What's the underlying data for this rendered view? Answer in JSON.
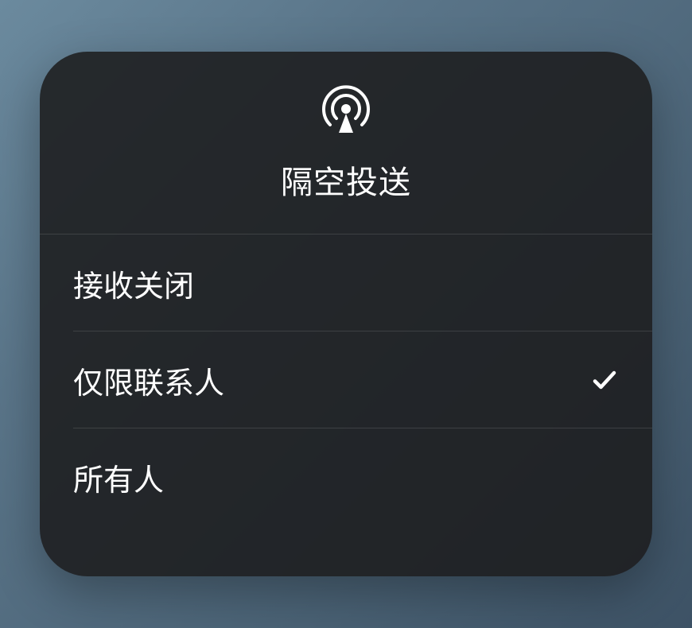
{
  "title": "隔空投送",
  "options": [
    {
      "label": "接收关闭",
      "selected": false
    },
    {
      "label": "仅限联系人",
      "selected": true
    },
    {
      "label": "所有人",
      "selected": false
    }
  ]
}
